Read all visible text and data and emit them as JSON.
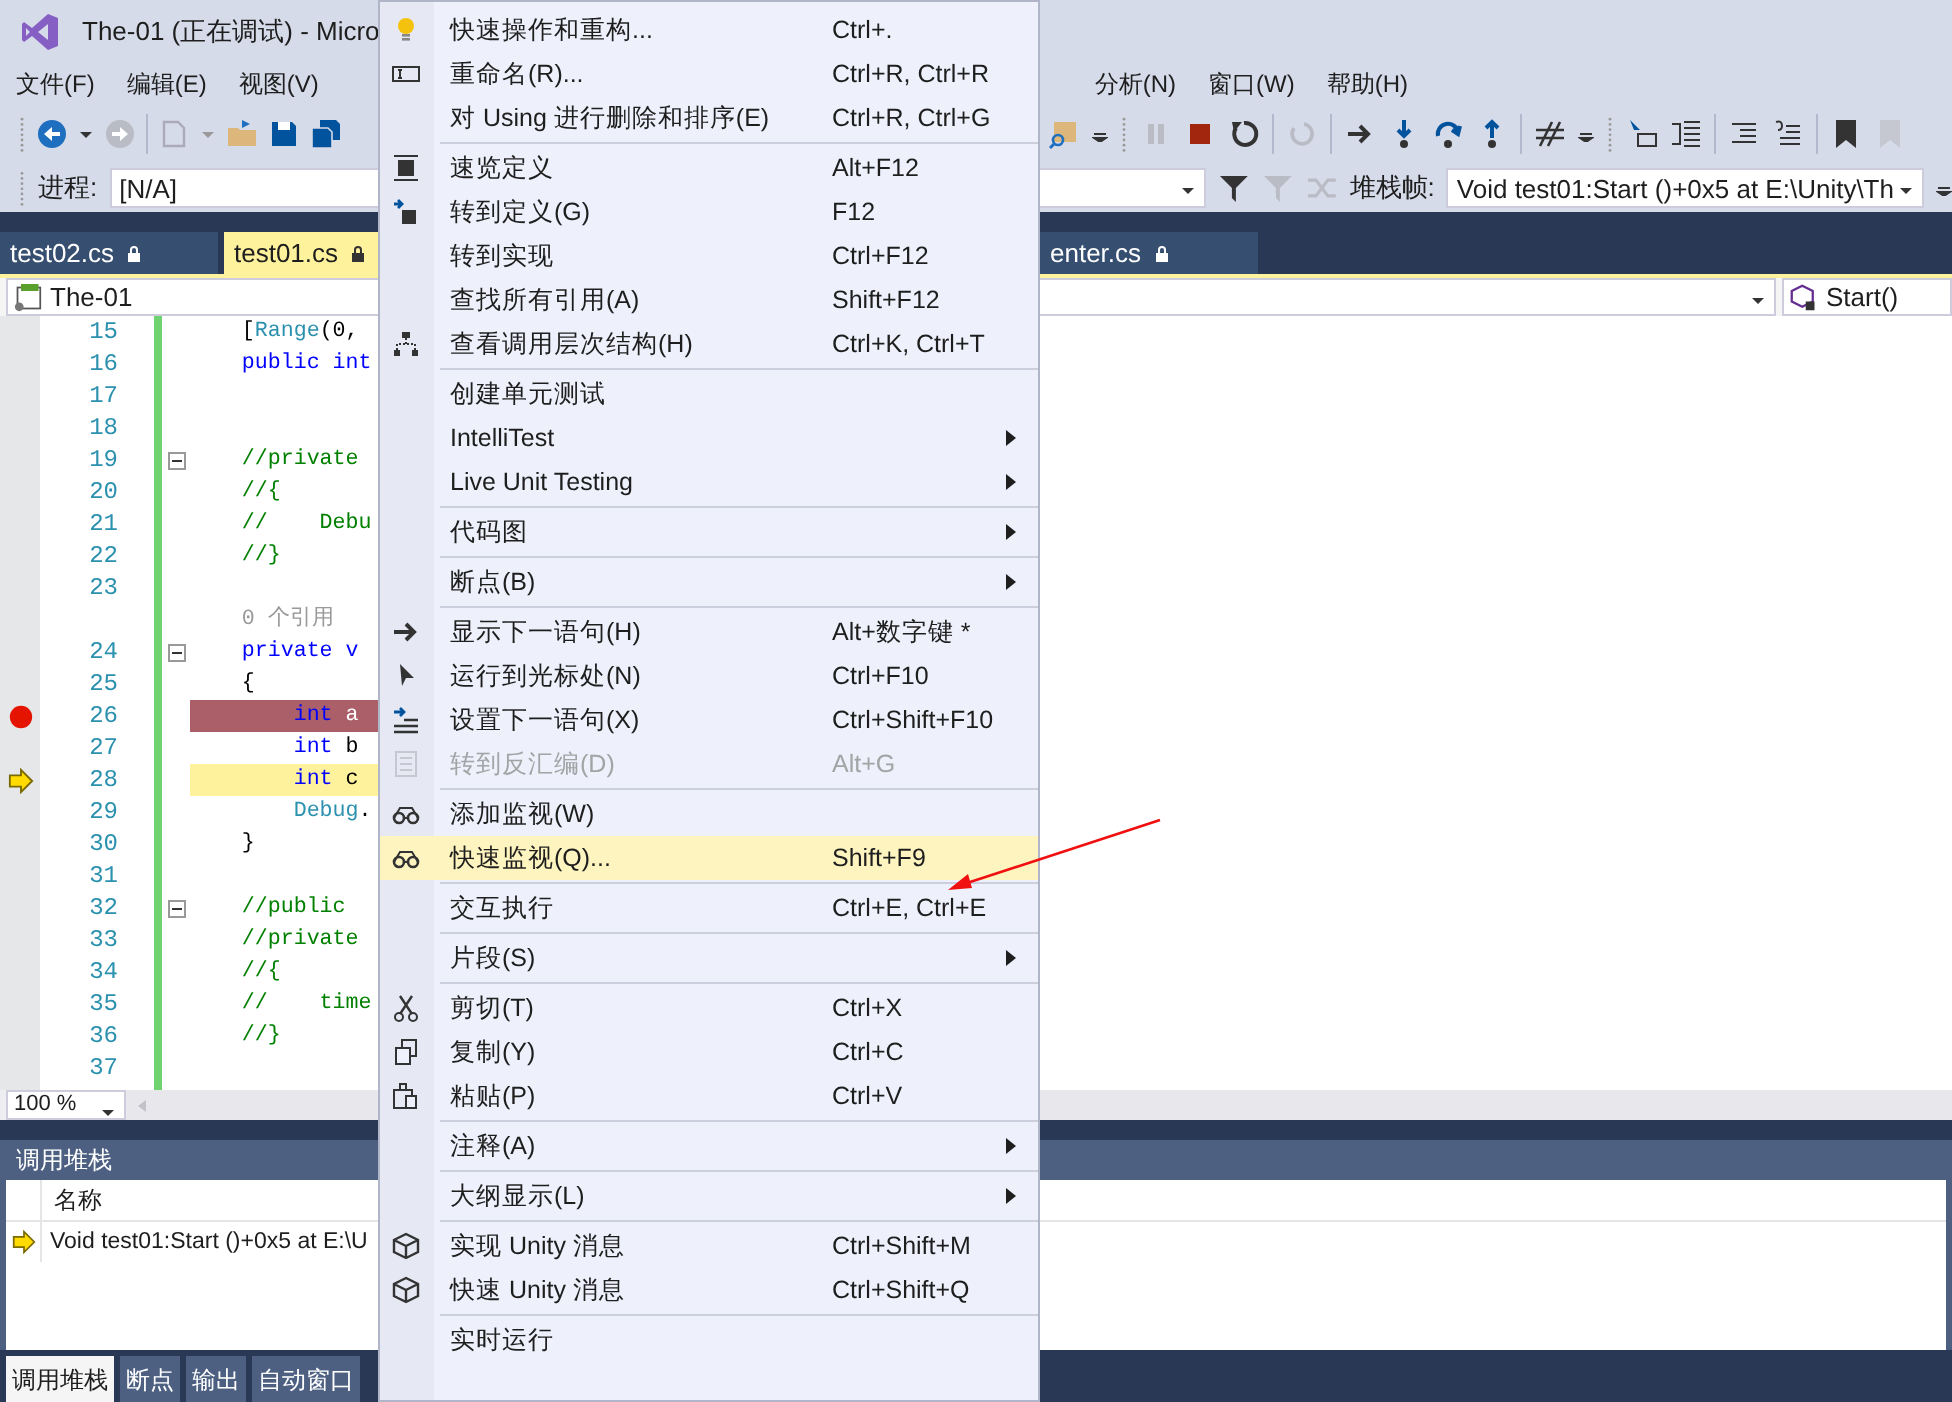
{
  "window": {
    "title": "The-01 (正在调试) - Micro"
  },
  "menu_bar": {
    "left": [
      "文件(F)",
      "编辑(E)",
      "视图(V)"
    ],
    "right": [
      "分析(N)",
      "窗口(W)",
      "帮助(H)"
    ]
  },
  "process": {
    "label": "进程:",
    "value": "[N/A]"
  },
  "stack_frame": {
    "label": "堆栈帧:",
    "value": "Void test01:Start ()+0x5 at E:\\Unity\\Th"
  },
  "tabs": [
    {
      "label": "test02.cs",
      "selected": false
    },
    {
      "label": "test01.cs",
      "selected": true
    },
    {
      "label": "enter.cs",
      "selected": false
    }
  ],
  "nav_bar": {
    "project": "The-01",
    "member": "Start()"
  },
  "code_lines": [
    {
      "number": "15",
      "kind": "plain",
      "fold": false,
      "segments": [
        {
          "kind": "pl",
          "s": "    ["
        },
        {
          "kind": "ty",
          "s": "Range"
        },
        {
          "kind": "pl",
          "s": "(0,"
        }
      ]
    },
    {
      "number": "16",
      "kind": "plain",
      "fold": false,
      "segments": [
        {
          "kind": "kw",
          "s": "    public int"
        }
      ]
    },
    {
      "number": "17",
      "kind": "plain",
      "fold": false
    },
    {
      "number": "18",
      "kind": "plain",
      "fold": false
    },
    {
      "number": "19",
      "kind": "plain",
      "fold": true,
      "segments": [
        {
          "kind": "cm",
          "s": "    //private"
        }
      ]
    },
    {
      "number": "20",
      "kind": "plain",
      "fold": false,
      "segments": [
        {
          "kind": "cm",
          "s": "    //{"
        }
      ]
    },
    {
      "number": "21",
      "kind": "plain",
      "fold": false,
      "segments": [
        {
          "kind": "cm",
          "s": "    //    Debu"
        }
      ]
    },
    {
      "number": "22",
      "kind": "plain",
      "fold": false,
      "segments": [
        {
          "kind": "cm",
          "s": "    //}"
        }
      ]
    },
    {
      "number": "23",
      "kind": "plain",
      "fold": false
    },
    {
      "kind": "lens",
      "segments": [
        {
          "kind": "lens",
          "s": "    0 个引用"
        }
      ]
    },
    {
      "number": "24",
      "kind": "plain",
      "fold": true,
      "segments": [
        {
          "kind": "kw",
          "s": "    private v"
        }
      ]
    },
    {
      "number": "25",
      "kind": "plain",
      "fold": false,
      "segments": [
        {
          "kind": "pl",
          "s": "    {"
        }
      ]
    },
    {
      "number": "26",
      "kind": "breakpoint",
      "fold": false,
      "segments": [
        {
          "kind": "kw",
          "s": "        int"
        },
        {
          "kind": "pl",
          "s": " a"
        }
      ]
    },
    {
      "number": "27",
      "kind": "plain",
      "fold": false,
      "segments": [
        {
          "kind": "kw",
          "s": "        int"
        },
        {
          "kind": "pl",
          "s": " b"
        }
      ]
    },
    {
      "number": "28",
      "kind": "current",
      "fold": false,
      "segments": [
        {
          "kind": "kw",
          "s": "        int"
        },
        {
          "kind": "pl",
          "s": " c"
        }
      ]
    },
    {
      "number": "29",
      "kind": "plain",
      "fold": false,
      "segments": [
        {
          "kind": "ty",
          "s": "        Debug"
        },
        {
          "kind": "pl",
          "s": "."
        }
      ]
    },
    {
      "number": "30",
      "kind": "plain",
      "fold": false,
      "segments": [
        {
          "kind": "pl",
          "s": "    }"
        }
      ]
    },
    {
      "number": "31",
      "kind": "plain",
      "fold": false
    },
    {
      "number": "32",
      "kind": "plain",
      "fold": true,
      "segments": [
        {
          "kind": "cm",
          "s": "    //public "
        }
      ]
    },
    {
      "number": "33",
      "kind": "plain",
      "fold": false,
      "segments": [
        {
          "kind": "cm",
          "s": "    //private"
        }
      ]
    },
    {
      "number": "34",
      "kind": "plain",
      "fold": false,
      "segments": [
        {
          "kind": "cm",
          "s": "    //{"
        }
      ]
    },
    {
      "number": "35",
      "kind": "plain",
      "fold": false,
      "segments": [
        {
          "kind": "cm",
          "s": "    //    time"
        }
      ]
    },
    {
      "number": "36",
      "kind": "plain",
      "fold": false,
      "segments": [
        {
          "kind": "cm",
          "s": "    //}"
        }
      ]
    },
    {
      "number": "37",
      "kind": "plain",
      "fold": false
    }
  ],
  "zoom": "100 %",
  "call_stack": {
    "title": "调用堆栈",
    "column": "名称",
    "rows": [
      {
        "text": "Void test01:Start ()+0x5 at E:\\U",
        "current": true
      }
    ]
  },
  "bottom_tabs": [
    {
      "label": "调用堆栈",
      "selected": true
    },
    {
      "label": "断点",
      "selected": false
    },
    {
      "label": "输出",
      "selected": false
    },
    {
      "label": "自动窗口",
      "selected": false
    }
  ],
  "context_menu": {
    "groups": [
      [
        {
          "label": "快速操作和重构...",
          "shortcut": "Ctrl+.",
          "submenu": false,
          "disabled": false,
          "selected": false
        },
        {
          "label": "重命名(R)...",
          "shortcut": "Ctrl+R, Ctrl+R",
          "submenu": false,
          "disabled": false,
          "selected": false
        },
        {
          "label": "对 Using 进行删除和排序(E)",
          "shortcut": "Ctrl+R, Ctrl+G",
          "submenu": false,
          "disabled": false,
          "selected": false
        }
      ],
      [
        {
          "label": "速览定义",
          "shortcut": "Alt+F12",
          "submenu": false,
          "disabled": false,
          "selected": false
        },
        {
          "label": "转到定义(G)",
          "shortcut": "F12",
          "submenu": false,
          "disabled": false,
          "selected": false
        },
        {
          "label": "转到实现",
          "shortcut": "Ctrl+F12",
          "submenu": false,
          "disabled": false,
          "selected": false
        },
        {
          "label": "查找所有引用(A)",
          "shortcut": "Shift+F12",
          "submenu": false,
          "disabled": false,
          "selected": false
        },
        {
          "label": "查看调用层次结构(H)",
          "shortcut": "Ctrl+K, Ctrl+T",
          "submenu": false,
          "disabled": false,
          "selected": false
        }
      ],
      [
        {
          "label": "创建单元测试",
          "submenu": false,
          "disabled": false,
          "selected": false
        },
        {
          "label": "IntelliTest",
          "submenu": true,
          "disabled": false,
          "selected": false
        },
        {
          "label": "Live Unit Testing",
          "submenu": true,
          "disabled": false,
          "selected": false
        }
      ],
      [
        {
          "label": "代码图",
          "submenu": true,
          "disabled": false,
          "selected": false
        }
      ],
      [
        {
          "label": "断点(B)",
          "submenu": true,
          "disabled": false,
          "selected": false
        }
      ],
      [
        {
          "label": "显示下一语句(H)",
          "shortcut": "Alt+数字键 *",
          "submenu": false,
          "disabled": false,
          "selected": false
        },
        {
          "label": "运行到光标处(N)",
          "shortcut": "Ctrl+F10",
          "submenu": false,
          "disabled": false,
          "selected": false
        },
        {
          "label": "设置下一语句(X)",
          "shortcut": "Ctrl+Shift+F10",
          "submenu": false,
          "disabled": false,
          "selected": false
        },
        {
          "label": "转到反汇编(D)",
          "shortcut": "Alt+G",
          "submenu": false,
          "disabled": true,
          "selected": false
        }
      ],
      [
        {
          "label": "添加监视(W)",
          "submenu": false,
          "disabled": false,
          "selected": false
        },
        {
          "label": "快速监视(Q)...",
          "shortcut": "Shift+F9",
          "submenu": false,
          "disabled": false,
          "selected": true
        }
      ],
      [
        {
          "label": "交互执行",
          "shortcut": "Ctrl+E, Ctrl+E",
          "submenu": false,
          "disabled": false,
          "selected": false
        }
      ],
      [
        {
          "label": "片段(S)",
          "submenu": true,
          "disabled": false,
          "selected": false
        }
      ],
      [
        {
          "label": "剪切(T)",
          "shortcut": "Ctrl+X",
          "submenu": false,
          "disabled": false,
          "selected": false
        },
        {
          "label": "复制(Y)",
          "shortcut": "Ctrl+C",
          "submenu": false,
          "disabled": false,
          "selected": false
        },
        {
          "label": "粘贴(P)",
          "shortcut": "Ctrl+V",
          "submenu": false,
          "disabled": false,
          "selected": false
        }
      ],
      [
        {
          "label": "注释(A)",
          "submenu": true,
          "disabled": false,
          "selected": false
        }
      ],
      [
        {
          "label": "大纲显示(L)",
          "submenu": true,
          "disabled": false,
          "selected": false
        }
      ],
      [
        {
          "label": "实现 Unity 消息",
          "shortcut": "Ctrl+Shift+M",
          "submenu": false,
          "disabled": false,
          "selected": false
        },
        {
          "label": "快速 Unity 消息",
          "shortcut": "Ctrl+Shift+Q",
          "submenu": false,
          "disabled": false,
          "selected": false
        }
      ],
      [
        {
          "label": "实时运行",
          "submenu": false,
          "disabled": false,
          "selected": false
        }
      ]
    ]
  }
}
